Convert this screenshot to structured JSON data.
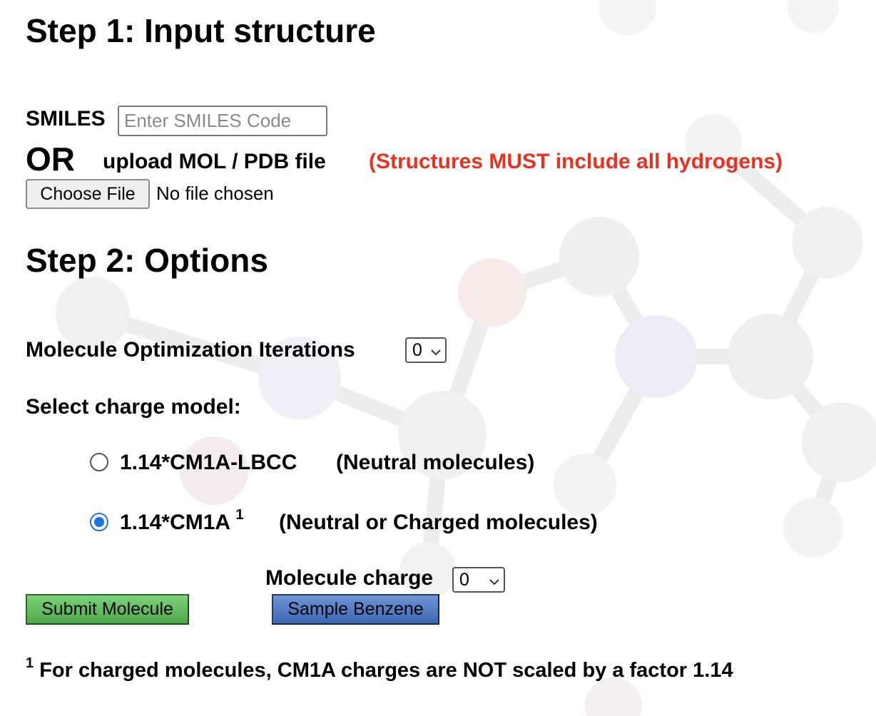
{
  "step1": {
    "heading": "Step 1: Input structure",
    "smiles_label": "SMILES",
    "smiles_placeholder": "Enter SMILES Code",
    "smiles_value": "",
    "or_label": "OR",
    "upload_label": "upload MOL / PDB file",
    "warning": "(Structures MUST include all hydrogens)",
    "choose_file_button": "Choose File",
    "file_status": "No file chosen"
  },
  "step2": {
    "heading": "Step 2: Options",
    "iterations_label": "Molecule Optimization Iterations",
    "iterations_value": "0",
    "charge_model_label": "Select charge model:",
    "options": [
      {
        "name": "1.14*CM1A-LBCC",
        "sup": "",
        "note": "(Neutral molecules)",
        "selected": false
      },
      {
        "name": "1.14*CM1A",
        "sup": "1",
        "note": "(Neutral or Charged molecules)",
        "selected": true
      }
    ],
    "molecule_charge_label": "Molecule charge",
    "molecule_charge_value": "0"
  },
  "buttons": {
    "submit": "Submit Molecule",
    "sample": "Sample Benzene"
  },
  "footnote": {
    "marker": "1",
    "text": "For charged molecules, CM1A charges are NOT scaled by a factor 1.14"
  },
  "colors": {
    "warning": "#e8321f",
    "submit_button": "#5cb85a",
    "sample_button": "#4a78c2",
    "radio_accent": "#1a73e8"
  },
  "icons": {
    "select_arrow": "chevron-down-icon",
    "background": "molecule-background-art"
  }
}
